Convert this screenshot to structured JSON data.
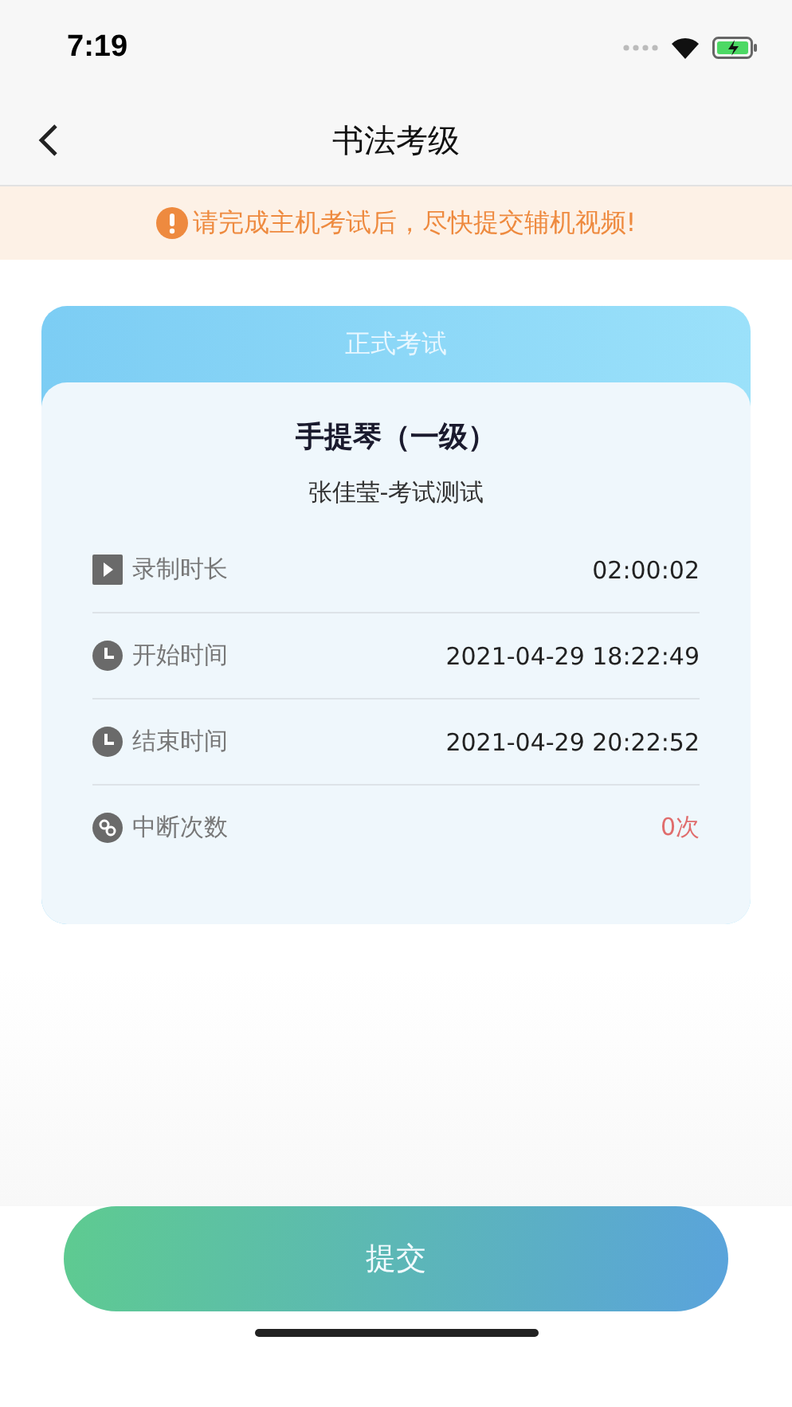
{
  "status_bar": {
    "time": "7:19"
  },
  "nav": {
    "title": "书法考级"
  },
  "notice": {
    "text": "请完成主机考试后，尽快提交辅机视频!"
  },
  "card": {
    "header": "正式考试",
    "title": "手提琴（一级）",
    "subtitle": "张佳莹-考试测试",
    "rows": [
      {
        "kind": "play",
        "label": "录制时长",
        "value": "02:00:02",
        "alert": false
      },
      {
        "kind": "clock",
        "label": "开始时间",
        "value": "2021-04-29 18:22:49",
        "alert": false
      },
      {
        "kind": "clock",
        "label": "结束时间",
        "value": "2021-04-29 20:22:52",
        "alert": false
      },
      {
        "kind": "link",
        "label": "中断次数",
        "value": "0次",
        "alert": true
      }
    ]
  },
  "submit_button": {
    "label": "提交"
  }
}
